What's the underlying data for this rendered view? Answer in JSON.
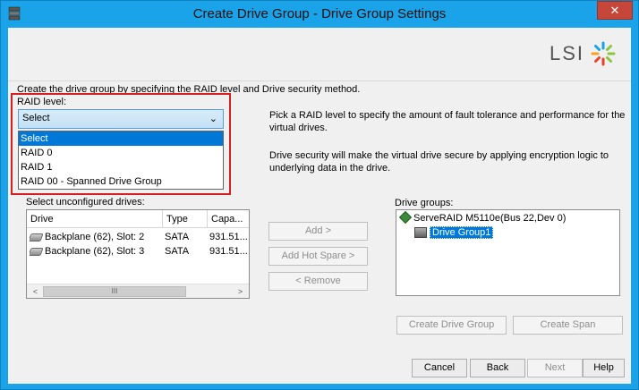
{
  "window": {
    "title": "Create Drive Group - Drive Group Settings",
    "close_label": "✕"
  },
  "header": {
    "logo_text": "LSI",
    "accent_color": "#1aa3e8"
  },
  "instruction": "Create the drive group by specifying the RAID level and Drive security method.",
  "raid": {
    "label": "RAID level:",
    "selected": "Select",
    "arrow": "⌄",
    "options": [
      "Select",
      "RAID 0",
      "RAID 1",
      "RAID 00 - Spanned Drive Group"
    ],
    "highlighted_index": 0
  },
  "descriptions": {
    "raid_help": "Pick a RAID level to specify the amount of fault tolerance and performance for the virtual drives.",
    "security_help": "Drive security will make the virtual drive secure by applying encryption logic to underlying data in the drive."
  },
  "unconfigured": {
    "label": "Select unconfigured drives:",
    "columns": [
      "Drive",
      "Type",
      "Capa..."
    ],
    "rows": [
      {
        "drive": "Backplane (62), Slot: 2",
        "type": "SATA",
        "capacity": "931.51..."
      },
      {
        "drive": "Backplane (62), Slot: 3",
        "type": "SATA",
        "capacity": "931.51..."
      }
    ],
    "scroll_thumb": "III",
    "scroll_left": "<",
    "scroll_right": ">"
  },
  "middle_buttons": {
    "add": "Add >",
    "add_hot_spare": "Add Hot Spare >",
    "remove": "< Remove"
  },
  "drive_groups": {
    "label": "Drive groups:",
    "root": "ServeRAID M5110e(Bus 22,Dev 0)",
    "child": "Drive Group1"
  },
  "group_buttons": {
    "create_drive_group": "Create Drive Group",
    "create_span": "Create Span"
  },
  "footer": {
    "cancel": "Cancel",
    "back": "Back",
    "next": "Next",
    "help": "Help"
  }
}
